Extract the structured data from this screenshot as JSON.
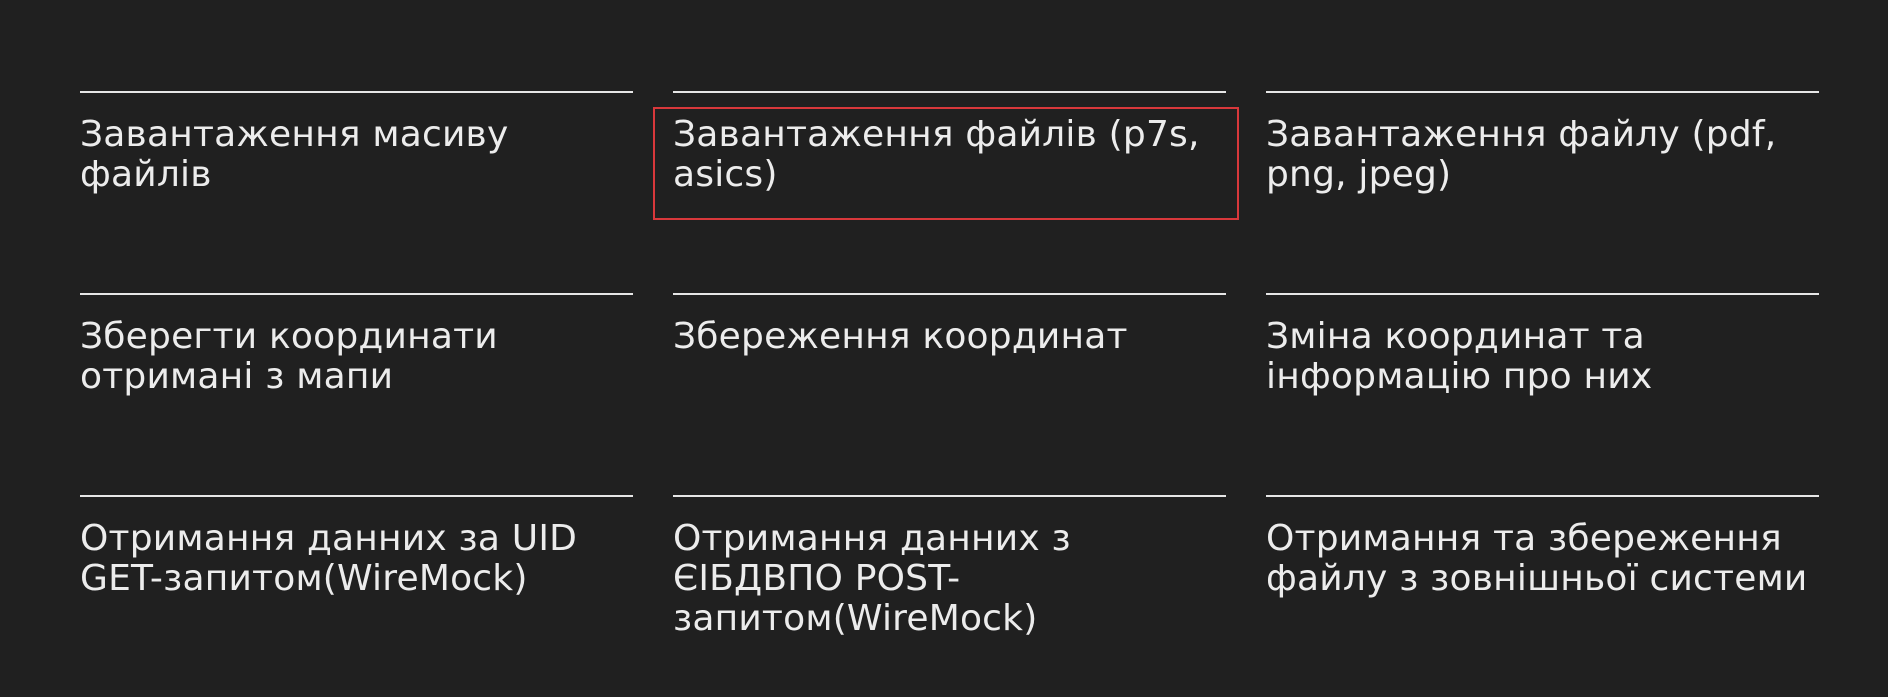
{
  "cards": [
    {
      "title": "Завантаження масиву файлів",
      "highlighted": false
    },
    {
      "title": "Завантаження файлів (p7s, asics)",
      "highlighted": true
    },
    {
      "title": "Завантаження файлу (pdf, png, jpeg)",
      "highlighted": false
    },
    {
      "title": "Зберегти координати отримані з мапи",
      "highlighted": false
    },
    {
      "title": "Збереження координат",
      "highlighted": false
    },
    {
      "title": "Зміна координат та інформацію про них",
      "highlighted": false
    },
    {
      "title": "Отримання данних за UID GET-запитом(WireMock)",
      "highlighted": false
    },
    {
      "title": "Отримання данних з ЄІБДВПО POST-запитом(WireMock)",
      "highlighted": false
    },
    {
      "title": "Отримання та збереження файлу з зовнішньої системи",
      "highlighted": false
    }
  ],
  "colors": {
    "background": "#202020",
    "text": "#ececec",
    "divider": "#e6e6e6",
    "highlight": "#d9383b"
  }
}
